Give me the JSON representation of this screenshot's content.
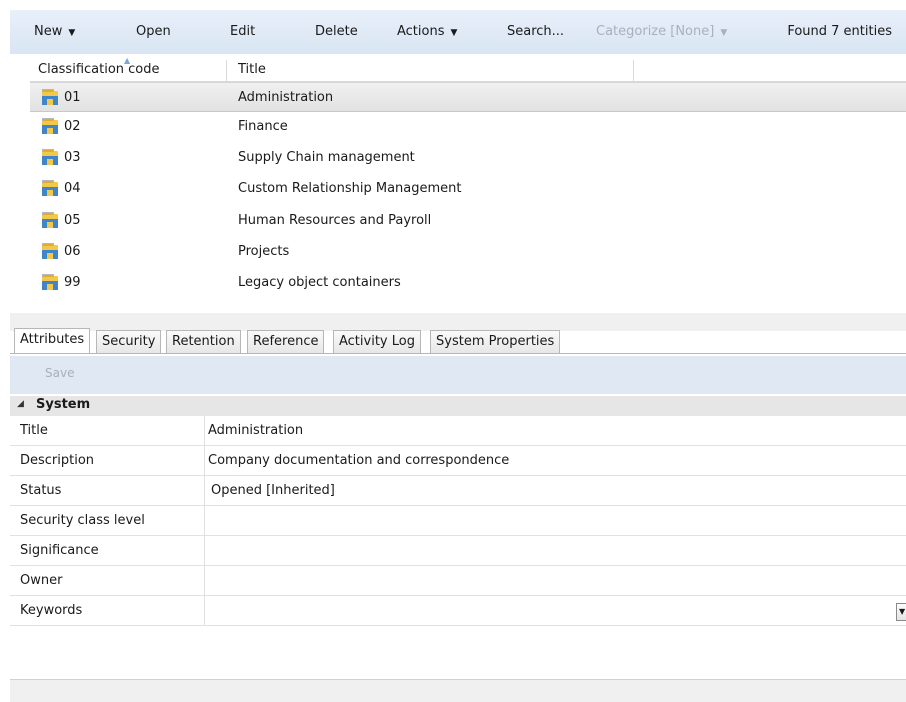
{
  "toolbar": {
    "new_label": "New",
    "open_label": "Open",
    "edit_label": "Edit",
    "delete_label": "Delete",
    "actions_label": "Actions",
    "search_label": "Search...",
    "categorize_label": "Categorize [None]",
    "status": "Found 7 entities"
  },
  "grid": {
    "columns": {
      "code": "Classification code",
      "title": "Title"
    },
    "rows": [
      {
        "code": "01",
        "title": "Administration"
      },
      {
        "code": "02",
        "title": "Finance"
      },
      {
        "code": "03",
        "title": "Supply Chain management"
      },
      {
        "code": "04",
        "title": "Custom Relationship Management"
      },
      {
        "code": "05",
        "title": "Human Resources and Payroll"
      },
      {
        "code": "06",
        "title": "Projects"
      },
      {
        "code": "99",
        "title": "Legacy object containers"
      }
    ]
  },
  "tabs": [
    "Attributes",
    "Security",
    "Retention",
    "Reference",
    "Activity Log",
    "System Properties"
  ],
  "save_label": "Save",
  "section_label": "System",
  "properties": [
    {
      "name": "Title",
      "value": "Administration"
    },
    {
      "name": "Description",
      "value": "Company documentation and correspondence"
    },
    {
      "name": "Status",
      "value": "Opened [Inherited]"
    },
    {
      "name": "Security class level",
      "value": ""
    },
    {
      "name": "Significance",
      "value": ""
    },
    {
      "name": "Owner",
      "value": ""
    },
    {
      "name": "Keywords",
      "value": ""
    }
  ]
}
